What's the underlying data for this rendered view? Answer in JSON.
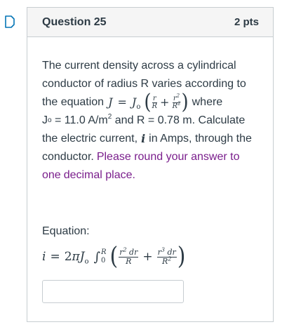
{
  "question": {
    "title": "Question 25",
    "points": "2 pts"
  },
  "body": {
    "line1": "The current density across a cylindrical",
    "line2": "conductor of radius R varies according to",
    "line3_prefix": "the equation",
    "line3_suffix": "where",
    "line4_jo": "J",
    "line4_jo_sub": "o",
    "line4_a": " = 11.0 A/m",
    "line4_sup": "2",
    "line4_b": " and R = 0.78 m. Calculate",
    "line5_a": "the electric current,",
    "line5_b": "in Amps, through the",
    "line6_a": "conductor.",
    "line6_purple": "Please round your answer to",
    "line7_purple": "decimal place.",
    "line7_purple_one": "one"
  },
  "equation": {
    "label": "Equation:"
  },
  "answer": {
    "value": "",
    "placeholder": ""
  },
  "colors": {
    "text": "#2d3b45",
    "accent_purple": "#7a1e8c",
    "header_bg": "#f5f5f5",
    "border": "#c7cdd1",
    "flag_blue": "#0374b5"
  },
  "icons": {
    "flag": "bookmark-flag-icon"
  }
}
